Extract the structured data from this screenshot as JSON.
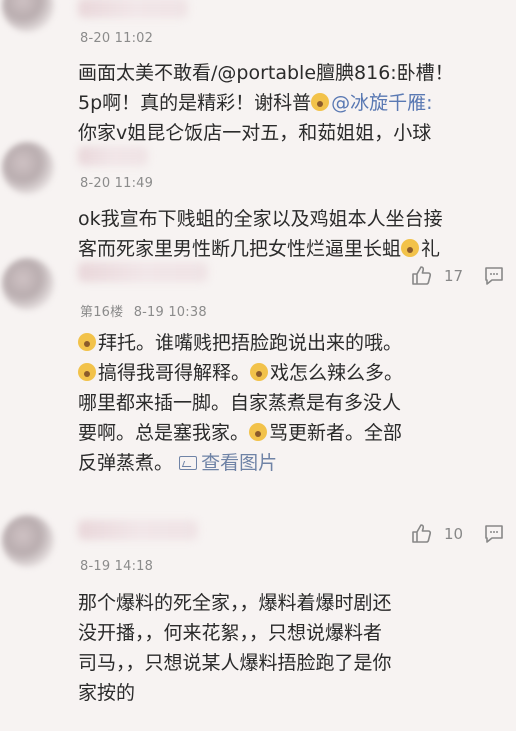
{
  "comments": [
    {
      "timestamp": "8-20 11:02",
      "lines": [
        "画面太美不敢看/@portable膻腆816:卧槽！",
        "5p啊！真的是精彩！谢科普",
        "你家v姐昆仑饭店一对五，和茹姐姐，小球"
      ],
      "mention": "@冰旋千雁:"
    },
    {
      "timestamp": "8-20 11:49",
      "lines": [
        "ok我宣布下贱蛆的全家以及鸡姐本人坐台接",
        "客而死家里男性断几把女性烂逼里长蛆",
        "礼"
      ],
      "likes": "17"
    },
    {
      "floor": "第16楼",
      "timestamp": "8-19 10:38",
      "lines": [
        "拜托。谁嘴贱把捂脸跑说出来的哦。",
        "搞得我哥得解释。",
        "戏怎么辣么多。",
        "哪里都来插一脚。自家蒸煮是有多没人",
        "要啊。总是塞我家。",
        "骂更新者。全部",
        "反弹蒸煮。"
      ],
      "view_images": "查看图片",
      "likes": "10"
    },
    {
      "timestamp": "8-19 14:18",
      "lines": [
        "那个爆料的死全家，，爆料着爆时剧还",
        "没开播，，何来花絮，，只想说爆料者",
        "司马，，只想说某人爆料捂脸跑了是你",
        "家按的"
      ]
    }
  ],
  "icons": {
    "like": "thumbs-up-icon",
    "comment": "comment-bubble-icon",
    "image": "image-icon",
    "emoji": "emoji-icon"
  },
  "colors": {
    "background": "#f7f3f2",
    "text": "#2b2b2b",
    "meta": "#8b8b8b",
    "link": "#5a79b3"
  }
}
